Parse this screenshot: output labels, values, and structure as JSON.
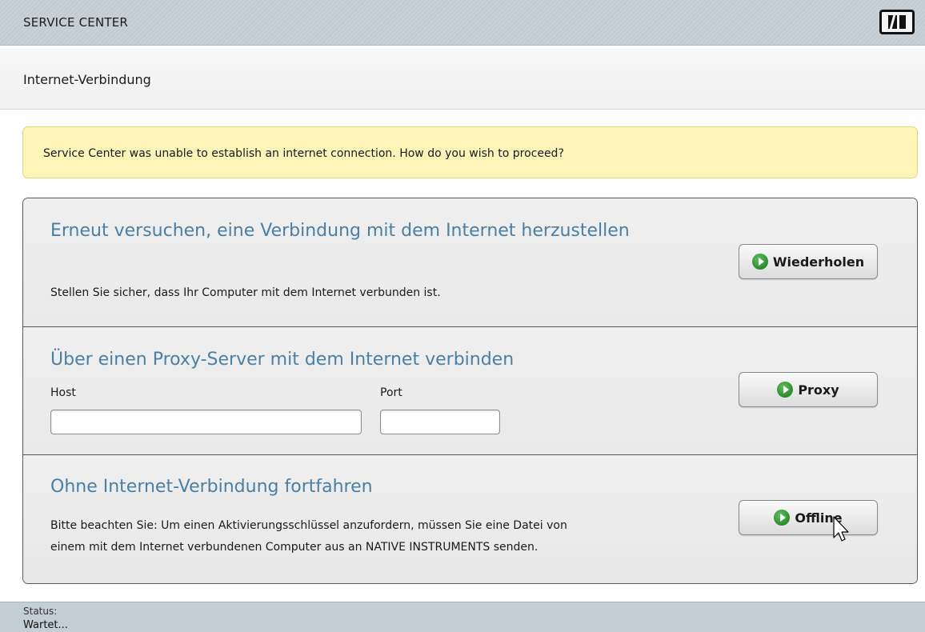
{
  "window": {
    "title": "SERVICE CENTER",
    "logo": "NI"
  },
  "page": {
    "title": "Internet-Verbindung"
  },
  "alert": {
    "message": "Service Center was unable to establish an internet connection. How do you wish to proceed?"
  },
  "sections": [
    {
      "title": "Erneut versuchen, eine Verbindung mit dem Internet herzustellen",
      "text": "Stellen Sie sicher, dass Ihr Computer mit dem Internet verbunden ist.",
      "button_label": "Wiederholen",
      "button_icon": "play-icon"
    },
    {
      "title": "Über einen Proxy-Server mit dem Internet verbinden",
      "host_label": "Host",
      "host_value": "",
      "port_label": "Port",
      "port_value": "",
      "button_label": "Proxy",
      "button_icon": "play-icon"
    },
    {
      "title": "Ohne Internet-Verbindung fortfahren",
      "text_line1": "Bitte beachten Sie: Um einen Aktivierungsschlüssel anzufordern, müssen Sie eine Datei von",
      "text_line2": "einem mit dem Internet verbundenen Computer aus an NATIVE INSTRUMENTS senden.",
      "button_label": "Offline",
      "button_icon": "play-icon"
    }
  ],
  "status": {
    "label": "Status:",
    "value": "Wartet..."
  },
  "colors": {
    "accent_title": "#4a7fa6",
    "alert_bg": "#fcf5b7",
    "status_bg": "#c3ced5"
  }
}
